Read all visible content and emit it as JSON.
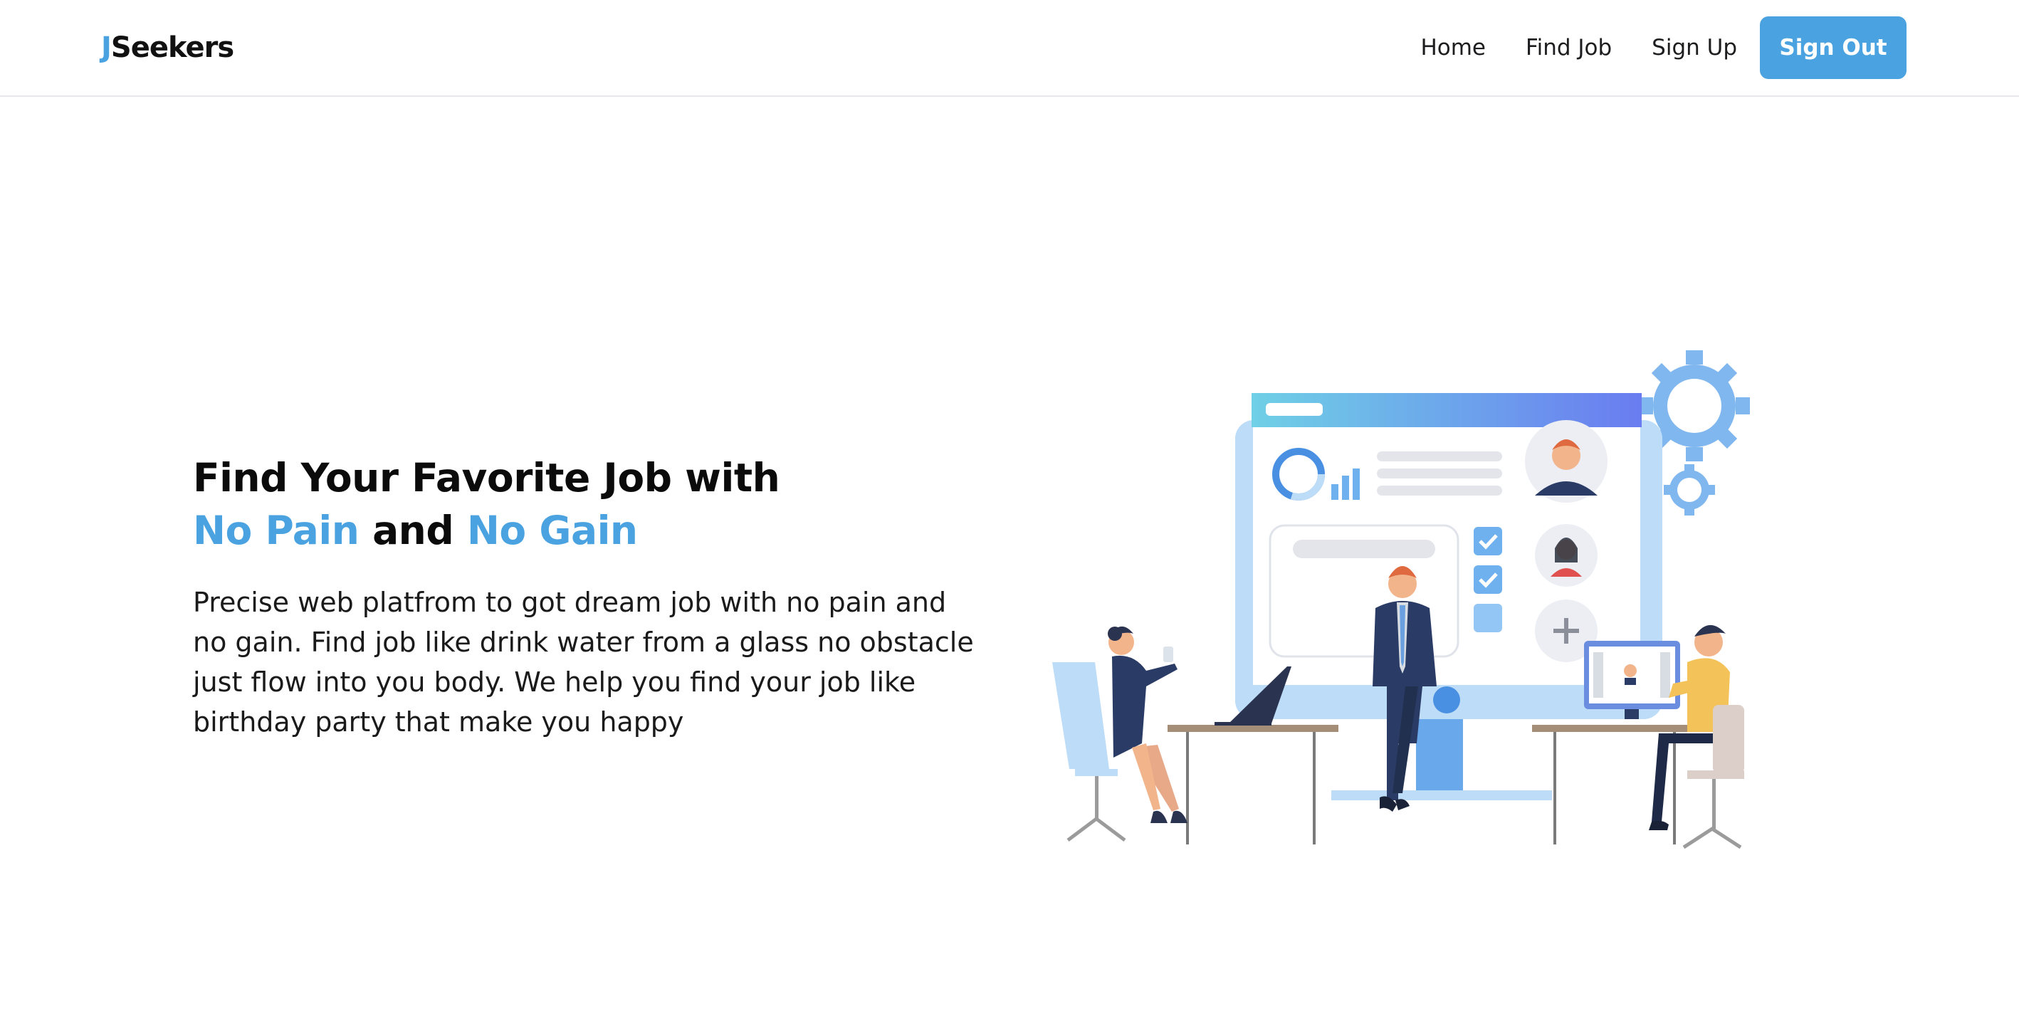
{
  "navbar": {
    "logo_accent": "J",
    "logo_rest": "Seekers",
    "links": [
      {
        "label": "Home"
      },
      {
        "label": "Find Job"
      },
      {
        "label": "Sign Up"
      }
    ],
    "signout_label": "Sign Out"
  },
  "hero": {
    "title_line1": "Find Your Favorite Job with",
    "title_accent1": "No Pain",
    "title_and": " and ",
    "title_accent2": "No Gain",
    "description": "Precise web platfrom to got dream job with no pain and no gain. Find job like drink water from a glass no obstacle just flow into you body. We help you find your job like birthday party that make you happy"
  },
  "colors": {
    "accent": "#4aa3e0",
    "text": "#111111",
    "background": "#ffffff"
  },
  "illustration": {
    "description_icon": "office-team-illustration"
  }
}
